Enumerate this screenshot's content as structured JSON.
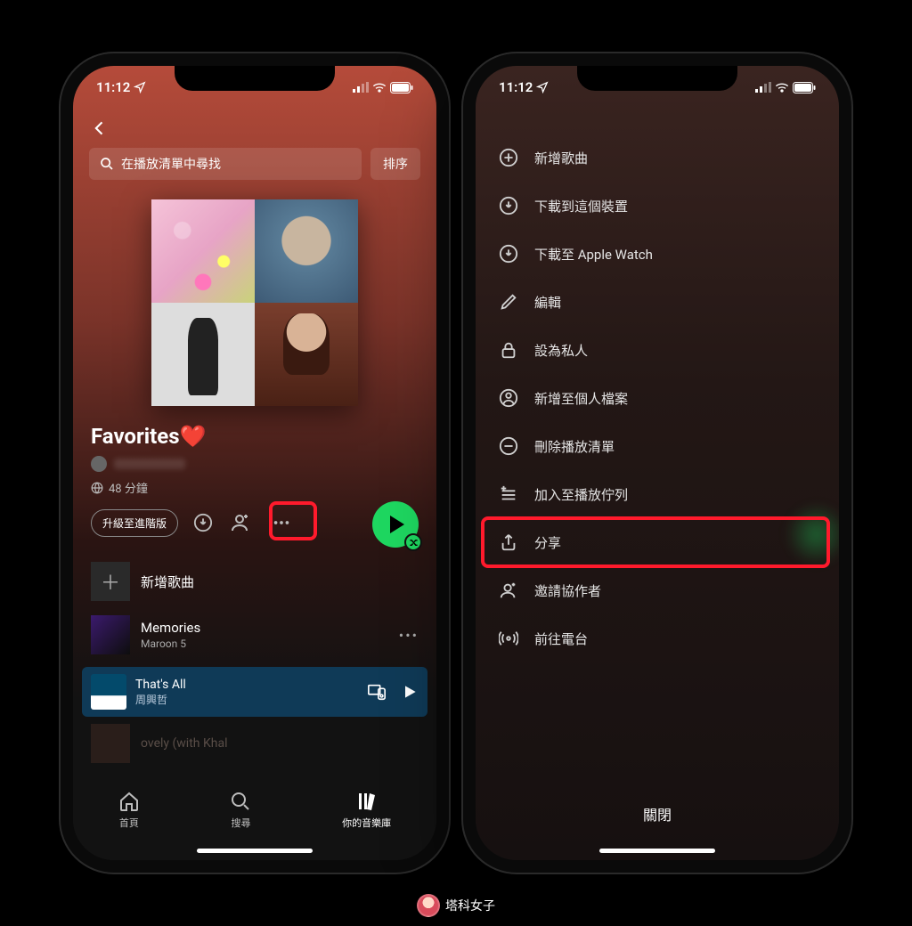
{
  "status": {
    "time": "11:12"
  },
  "screenA": {
    "search_placeholder": "在播放清單中尋找",
    "sort_label": "排序",
    "playlist_title": "Favorites❤️",
    "duration": "48 分鐘",
    "upgrade_label": "升級至進階版",
    "add_song_label": "新增歌曲",
    "tracks": [
      {
        "title": "Memories",
        "artist": "Maroon 5"
      }
    ],
    "now_playing": {
      "title": "That's All",
      "artist": "周興哲"
    },
    "faded_title": "ovely (with Khal",
    "tabs": {
      "home": "首頁",
      "search": "搜尋",
      "library": "你的音樂庫"
    }
  },
  "screenB": {
    "menu": {
      "add_song": "新增歌曲",
      "download_device": "下載到這個裝置",
      "download_watch": "下載至 Apple Watch",
      "edit": "編輯",
      "make_private": "設為私人",
      "add_profile": "新增至個人檔案",
      "delete": "刪除播放清單",
      "add_queue": "加入至播放佇列",
      "share": "分享",
      "invite": "邀請協作者",
      "radio": "前往電台"
    },
    "close": "關閉"
  },
  "watermark": "塔科女子"
}
